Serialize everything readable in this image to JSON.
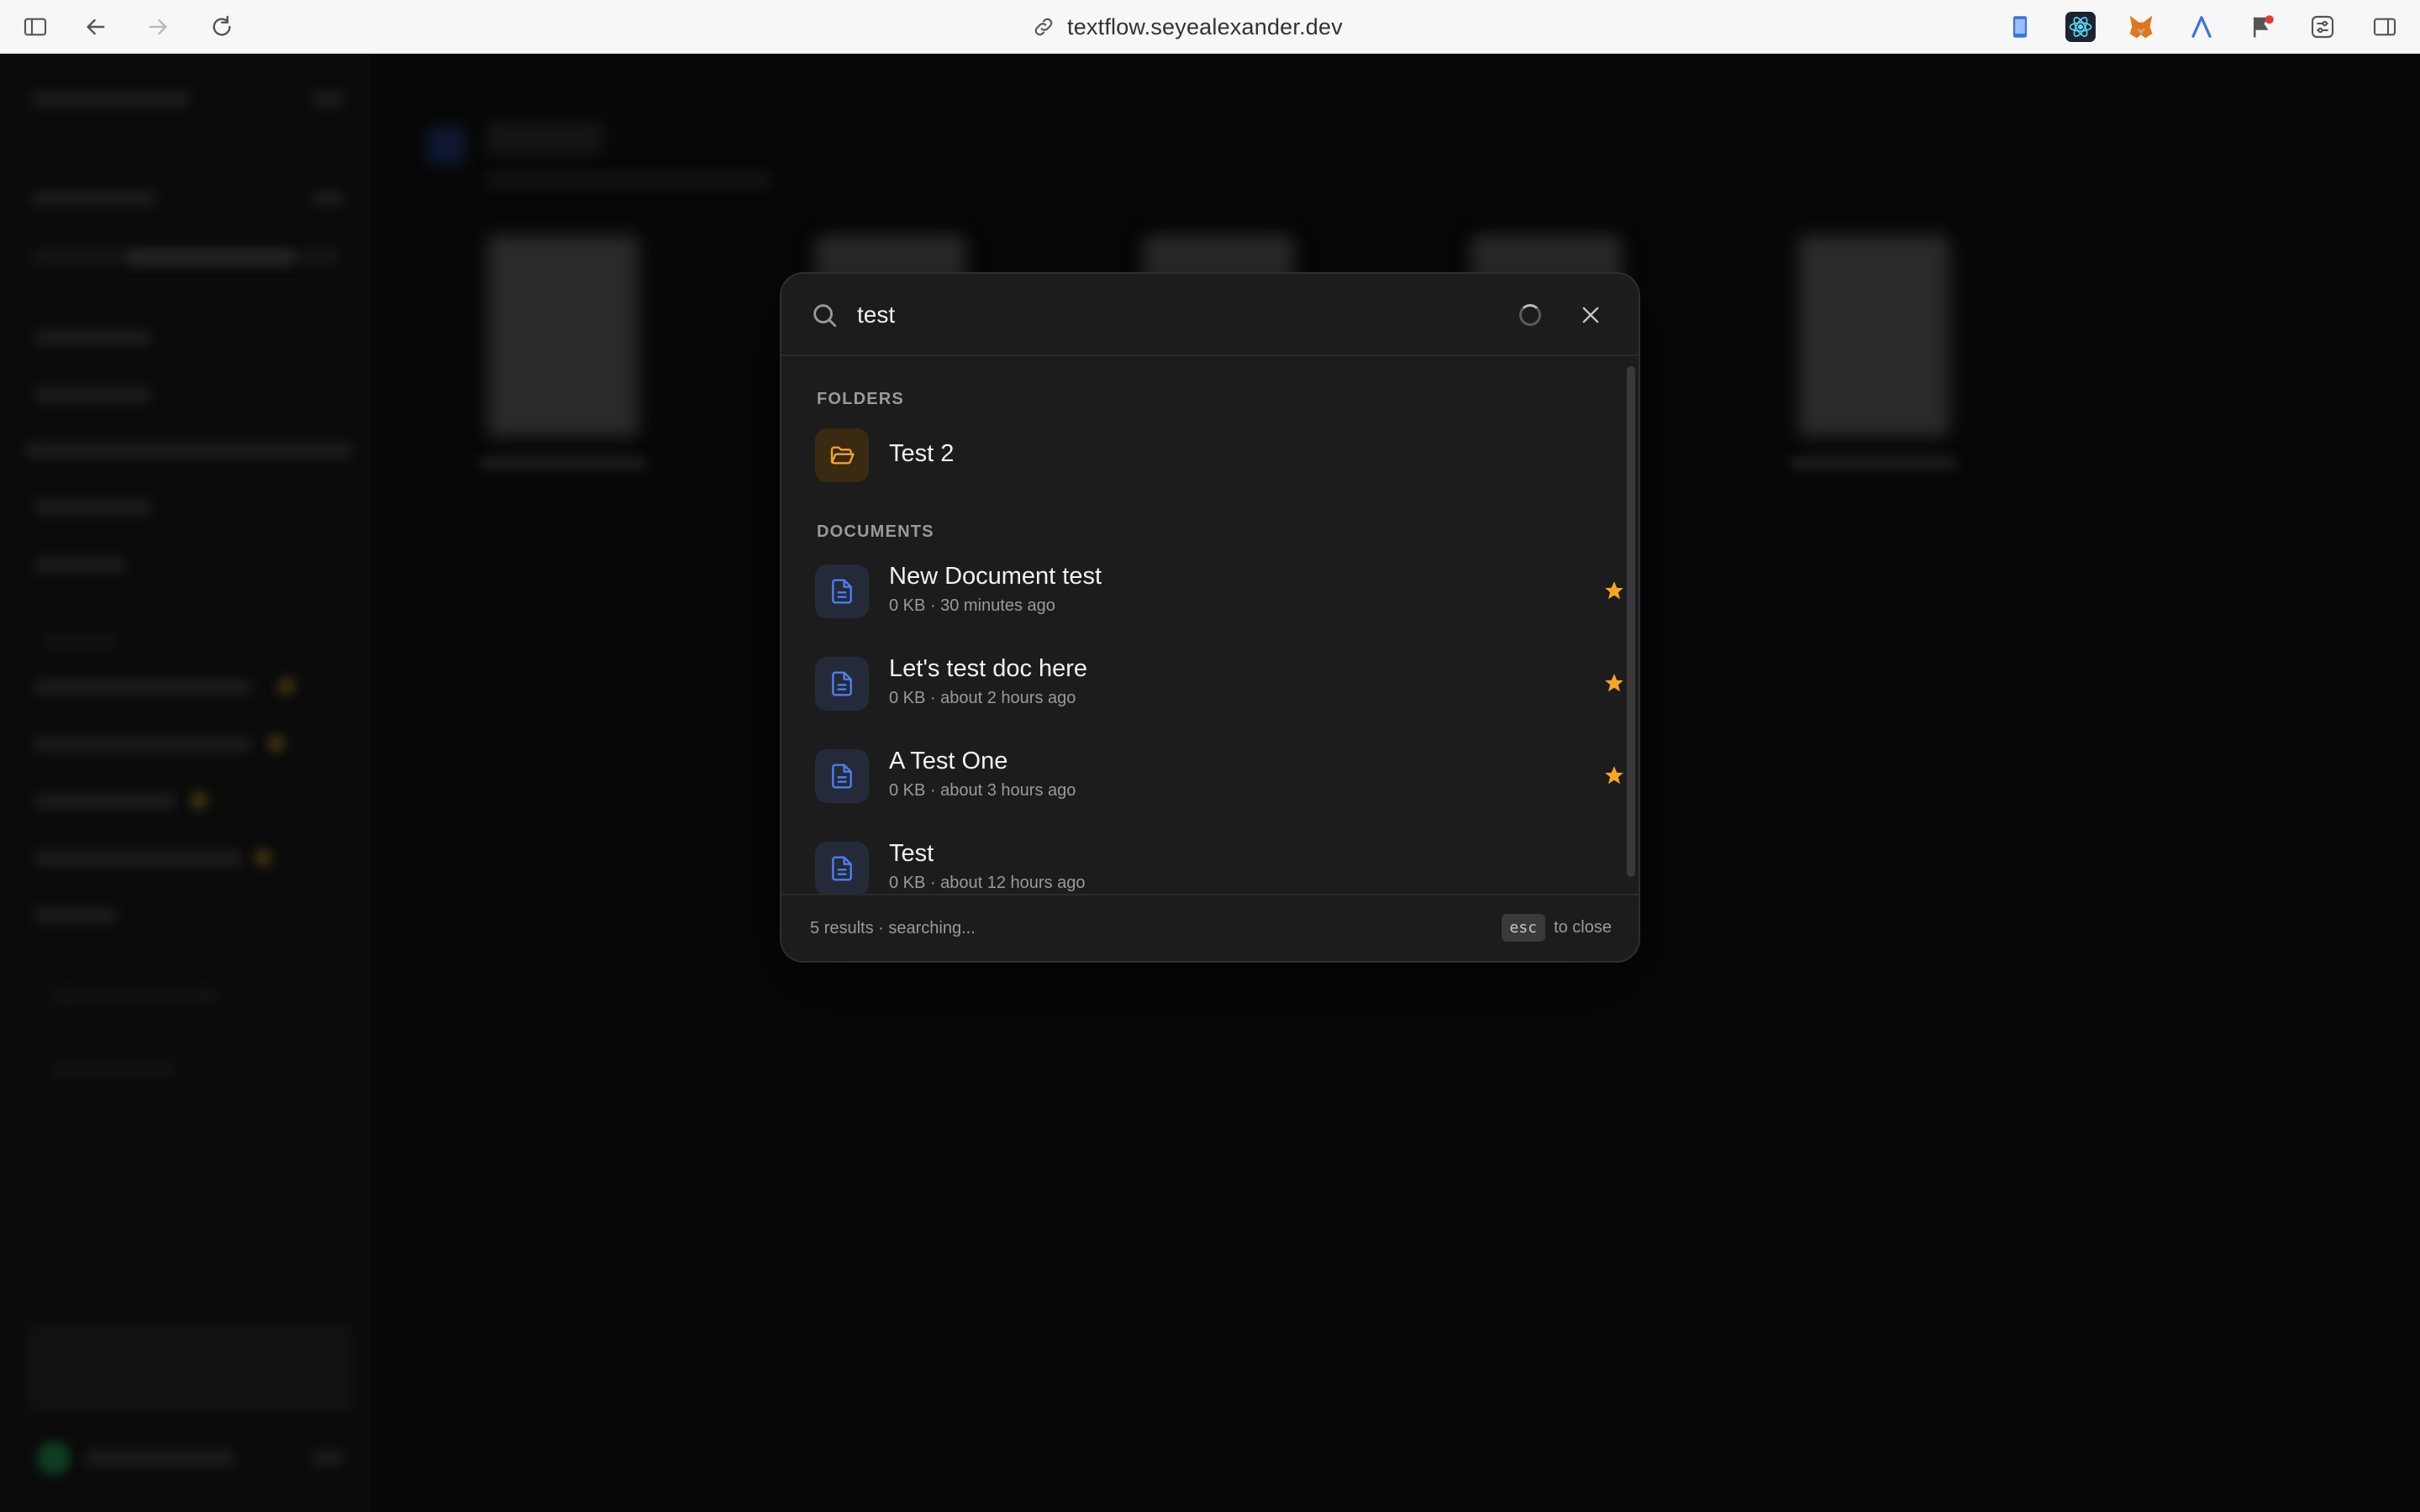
{
  "browser": {
    "url": "textflow.seyealexander.dev",
    "icons": [
      "sidebar-toggle-icon",
      "back-arrow-icon",
      "forward-arrow-icon",
      "reload-icon",
      "link-icon",
      "tab-overview-icon"
    ],
    "extensions": [
      "phone-extension-icon",
      "react-devtools-icon",
      "metamask-fox-icon",
      "arc-a-icon",
      "bookmark-flag-icon",
      "sliders-extension-icon"
    ]
  },
  "search": {
    "query": "test",
    "folders_label": "FOLDERS",
    "documents_label": "DOCUMENTS",
    "folders": [
      {
        "name": "Test 2"
      }
    ],
    "documents": [
      {
        "title": "New Document test",
        "meta": "0 KB · 30 minutes ago",
        "starred": true
      },
      {
        "title": "Let's test doc here",
        "meta": "0 KB · about 2 hours ago",
        "starred": true
      },
      {
        "title": "A Test One",
        "meta": "0 KB · about 3 hours ago",
        "starred": true
      },
      {
        "title": "Test",
        "meta": "0 KB · about 12 hours ago",
        "starred": false
      }
    ],
    "footer_status": "5 results · searching...",
    "footer_key": "esc",
    "footer_hint": "to close"
  },
  "colors": {
    "folder_accent": "#f0a232",
    "doc_accent": "#4f7ef0",
    "star": "#f5a623",
    "modal_bg": "#1c1c1d"
  }
}
